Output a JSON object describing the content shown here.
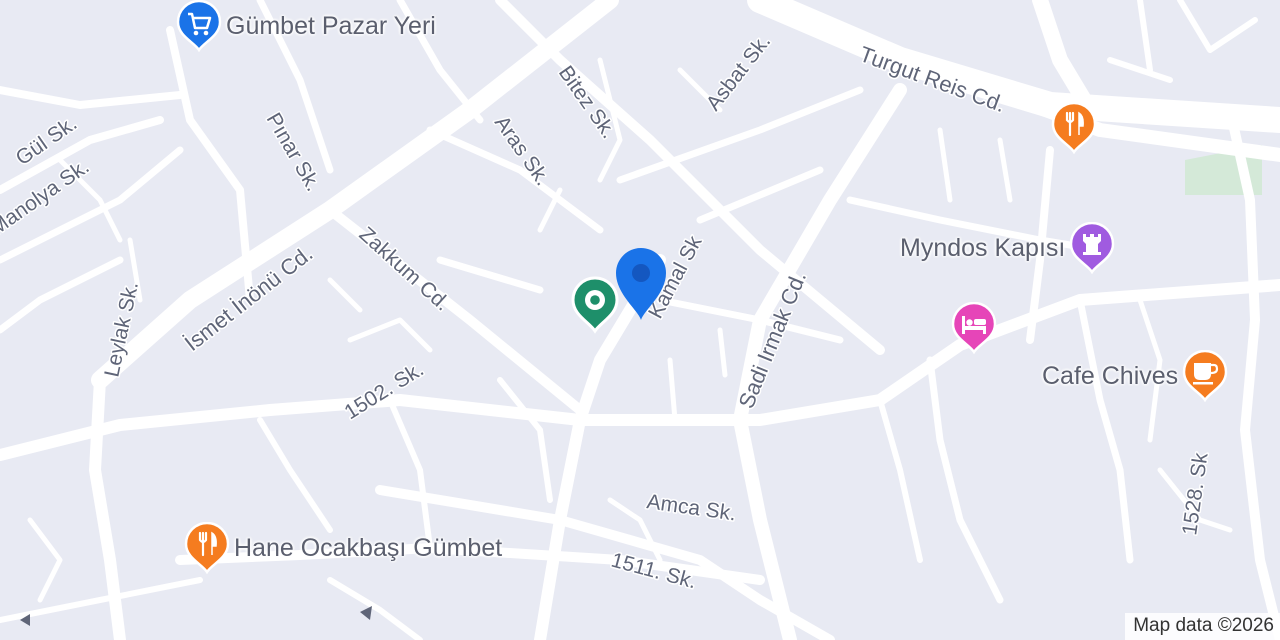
{
  "map": {
    "attribution": "Map data ©2026",
    "colors": {
      "background": "#e8eaf3",
      "road": "#ffffff",
      "park": "#d4e9d8",
      "street_label": "#5f6578",
      "shopping": "#1a73e8",
      "restaurant": "#f57c1f",
      "landmark": "#a05be0",
      "hotel": "#e645b8",
      "cafe": "#f57c1f",
      "selected_marker": "#1a73e8",
      "green_marker": "#1e8f6a"
    }
  },
  "streets": [
    {
      "name": "Bitez Sk."
    },
    {
      "name": "Asbat Sk."
    },
    {
      "name": "Turgut Reis Cd."
    },
    {
      "name": "Gül Sk."
    },
    {
      "name": "Manolya Sk."
    },
    {
      "name": "Pınar Sk."
    },
    {
      "name": "Aras Sk."
    },
    {
      "name": "Kamal Sk"
    },
    {
      "name": "İsmet İnönü Cd."
    },
    {
      "name": "Zakkum Cd."
    },
    {
      "name": "Leylak Sk."
    },
    {
      "name": "Sadi Irmak Cd."
    },
    {
      "name": "1502. Sk."
    },
    {
      "name": "Amca Sk."
    },
    {
      "name": "1511. Sk."
    },
    {
      "name": "1528. Sk"
    }
  ],
  "pois": [
    {
      "name": "Gümbet Pazar Yeri",
      "icon": "shopping-cart-icon",
      "category": "shopping"
    },
    {
      "name": "Hane Ocakbaşı Gümbet",
      "icon": "fork-knife-icon",
      "category": "restaurant"
    },
    {
      "name": "Myndos Kapısı",
      "icon": "castle-tower-icon",
      "category": "landmark"
    },
    {
      "name": "Cafe Chives",
      "icon": "coffee-cup-icon",
      "category": "cafe"
    },
    {
      "name": "",
      "icon": "fork-knife-icon",
      "category": "restaurant"
    },
    {
      "name": "",
      "icon": "bed-icon",
      "category": "hotel"
    }
  ]
}
